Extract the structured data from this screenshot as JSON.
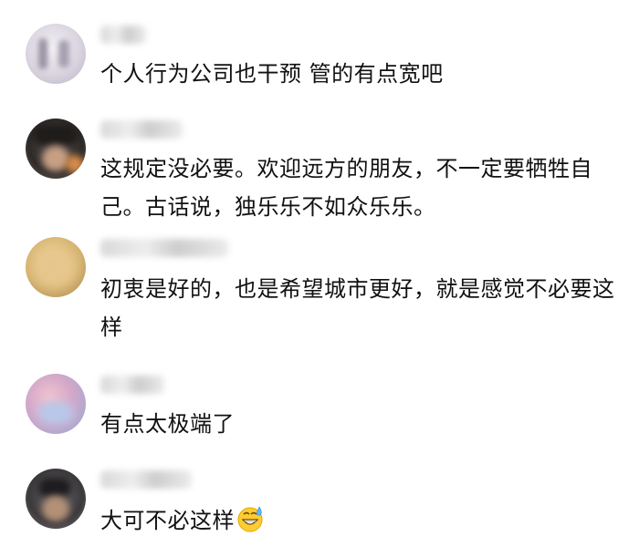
{
  "comments": [
    {
      "text": "个人行为公司也干预 管的有点宽吧"
    },
    {
      "text": "这规定没必要。欢迎远方的朋友，不一定要牺牲自己。古话说，独乐乐不如众乐乐。"
    },
    {
      "text": "初衷是好的，也是希望城市更好，就是感觉不必要这样"
    },
    {
      "text": "有点太极端了"
    },
    {
      "text": "大可不必这样",
      "emoji": "grinning-sweat-emoji"
    }
  ]
}
